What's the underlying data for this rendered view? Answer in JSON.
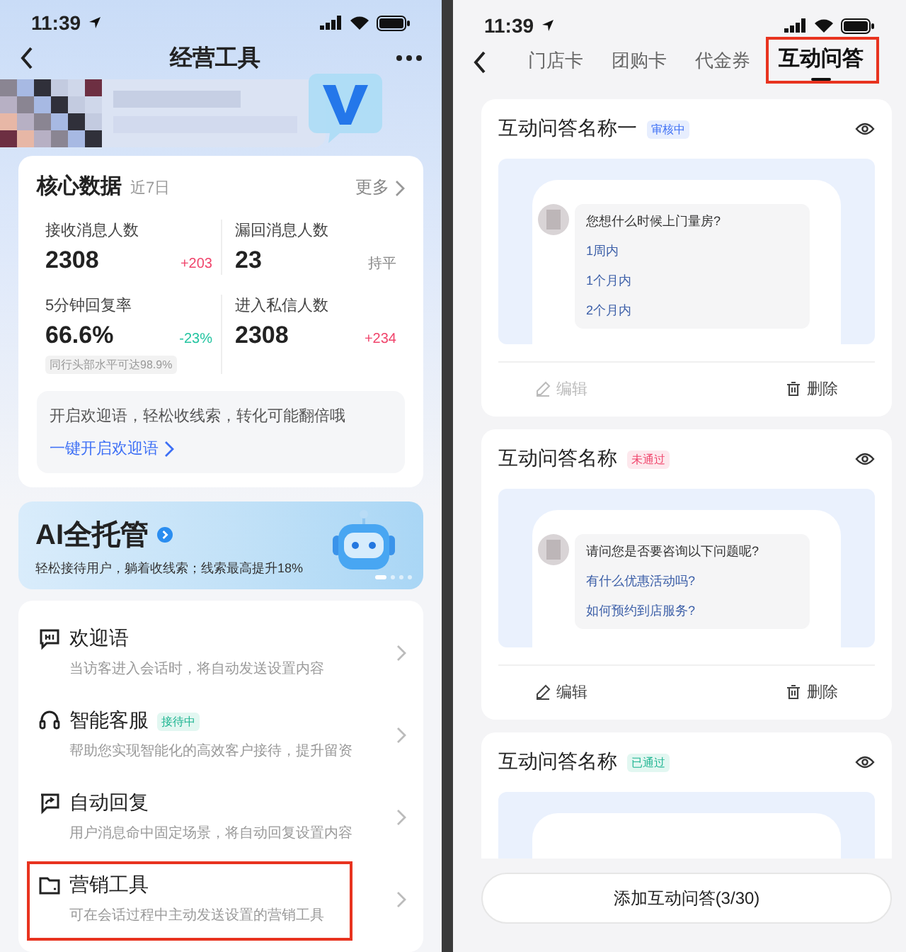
{
  "left": {
    "status_bar": {
      "time": "11:39"
    },
    "title": "经营工具",
    "core_data": {
      "title": "核心数据",
      "period": "近7日",
      "more": "更多",
      "metrics": [
        {
          "label": "接收消息人数",
          "value": "2308",
          "change": "+203",
          "color": "#f0446b"
        },
        {
          "label": "漏回消息人数",
          "value": "23",
          "change": "持平",
          "color": "#888888"
        },
        {
          "label": "5分钟回复率",
          "value": "66.6%",
          "change": "-23%",
          "color": "#23c4a0",
          "note": "同行头部水平可达98.9%"
        },
        {
          "label": "进入私信人数",
          "value": "2308",
          "change": "+234",
          "color": "#f0446b"
        }
      ],
      "tip": {
        "text": "开启欢迎语，轻松收线索，转化可能翻倍哦",
        "link": "一键开启欢迎语"
      }
    },
    "banner": {
      "title": "AI全托管",
      "subtitle": "轻松接待用户，躺着收线索；线索最高提升18%",
      "dots": [
        {
          "selected": true
        },
        {
          "selected": false
        },
        {
          "selected": false
        },
        {
          "selected": false
        }
      ]
    },
    "menu": [
      {
        "kind": "greeting",
        "title": "欢迎语",
        "desc": "当访客进入会话时，将自动发送设置内容",
        "highlighted": false
      },
      {
        "kind": "service",
        "title": "智能客服",
        "badge": "接待中",
        "desc": "帮助您实现智能化的高效客户接待，提升留资",
        "highlighted": false
      },
      {
        "kind": "reply",
        "title": "自动回复",
        "desc": "用户消息命中固定场景，将自动回复设置内容",
        "highlighted": false
      },
      {
        "kind": "marketing",
        "title": "营销工具",
        "desc": "可在会话过程中主动发送设置的营销工具",
        "highlighted": true
      }
    ]
  },
  "right": {
    "status_bar": {
      "time": "11:39"
    },
    "tabs": [
      {
        "label": "门店卡",
        "selected": false,
        "highlighted": false
      },
      {
        "label": "团购卡",
        "selected": false,
        "highlighted": false
      },
      {
        "label": "代金券",
        "selected": false,
        "highlighted": false
      },
      {
        "label": "互动问答",
        "selected": true,
        "highlighted": true
      }
    ],
    "cards": [
      {
        "title": "互动问答名称一",
        "status": {
          "label": "审核中",
          "kind": "review"
        },
        "preview": {
          "question": "您想什么时候上门量房?",
          "options": [
            "1周内",
            "1个月内",
            "2个月内"
          ]
        },
        "edit": {
          "label": "编辑",
          "disabled": true
        },
        "delete": "删除"
      },
      {
        "title": "互动问答名称",
        "status": {
          "label": "未通过",
          "kind": "rejected"
        },
        "preview": {
          "question": "请问您是否要咨询以下问题呢?",
          "options": [
            "有什么优惠活动吗?",
            "如何预约到店服务?"
          ]
        },
        "edit": {
          "label": "编辑",
          "disabled": false
        },
        "delete": "删除"
      },
      {
        "title": "互动问答名称",
        "status": {
          "label": "已通过",
          "kind": "approved"
        }
      }
    ],
    "add_button": "添加互动问答(3/30)"
  }
}
